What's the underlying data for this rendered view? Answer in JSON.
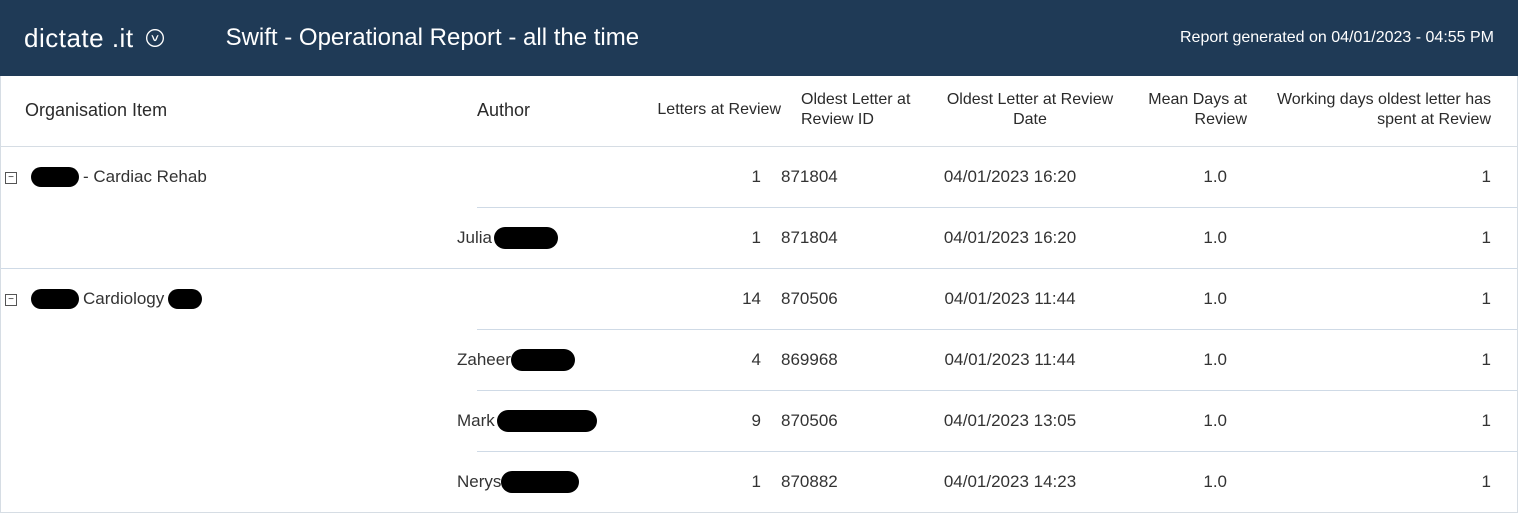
{
  "header": {
    "brand": "dictate .it",
    "title": "Swift - Operational Report - all the time",
    "generated": "Report generated on 04/01/2023 - 04:55 PM"
  },
  "columns": {
    "org": "Organisation Item",
    "author": "Author",
    "letters": "Letters at Review",
    "oldest_id": "Oldest Letter at Review ID",
    "oldest_date": "Oldest Letter at Review Date",
    "mean_days": "Mean Days at Review",
    "working_days": "Working days oldest letter has spent at Review"
  },
  "groups": [
    {
      "label_suffix": "- Cardiac Rehab",
      "letters": "1",
      "oldest_id": "871804",
      "oldest_date": "04/01/2023 16:20",
      "mean_days": "1.0",
      "working_days": "1",
      "authors": [
        {
          "name_prefix": "Julia",
          "letters": "1",
          "oldest_id": "871804",
          "oldest_date": "04/01/2023 16:20",
          "mean_days": "1.0",
          "working_days": "1"
        }
      ]
    },
    {
      "label_mid": " Cardiology ",
      "letters": "14",
      "oldest_id": "870506",
      "oldest_date": "04/01/2023 11:44",
      "mean_days": "1.0",
      "working_days": "1",
      "authors": [
        {
          "name_prefix": "Zaheer",
          "letters": "4",
          "oldest_id": "869968",
          "oldest_date": "04/01/2023 11:44",
          "mean_days": "1.0",
          "working_days": "1"
        },
        {
          "name_prefix": "Mark",
          "letters": "9",
          "oldest_id": "870506",
          "oldest_date": "04/01/2023 13:05",
          "mean_days": "1.0",
          "working_days": "1"
        },
        {
          "name_prefix": "Nerys",
          "letters": "1",
          "oldest_id": "870882",
          "oldest_date": "04/01/2023 14:23",
          "mean_days": "1.0",
          "working_days": "1"
        }
      ]
    }
  ]
}
